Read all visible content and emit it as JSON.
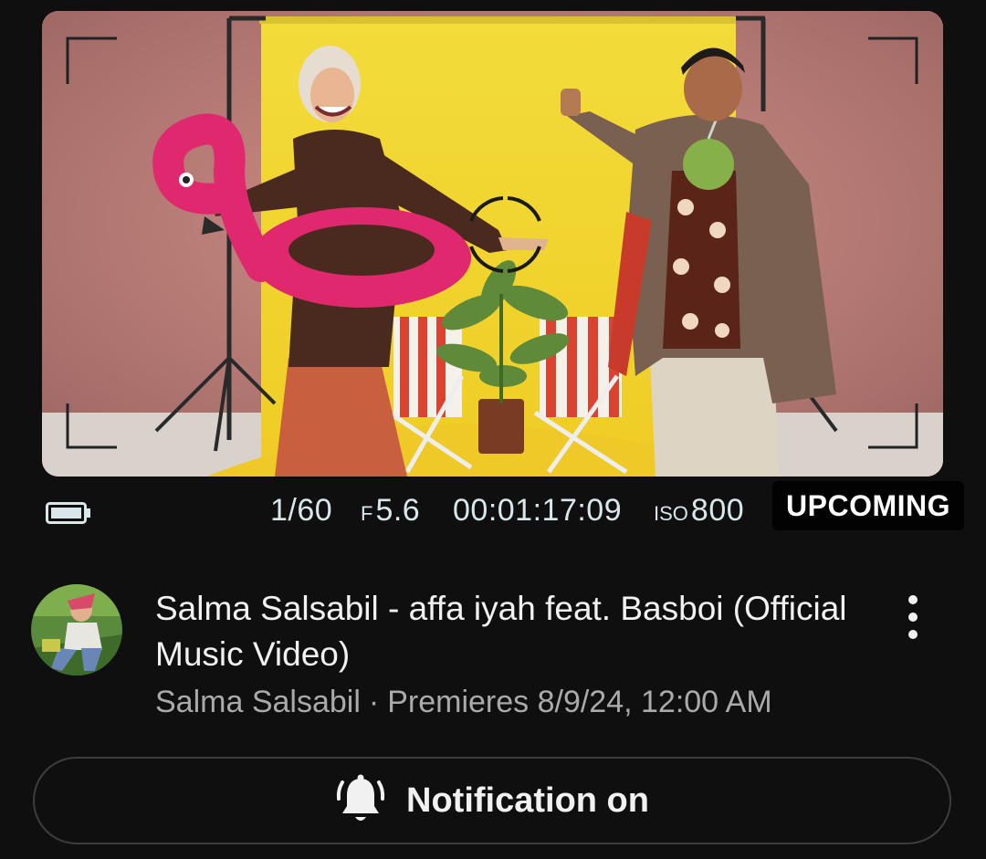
{
  "video": {
    "title": "Salma Salsabil - affa iyah feat. Basboi (Official Music Video)",
    "channel": "Salma Salsabil",
    "separator": "·",
    "premiere": "Premieres 8/9/24, 12:00 AM",
    "status_badge": "UPCOMING"
  },
  "thumbnail": {
    "camera": {
      "shutter": "1/60",
      "aperture_prefix": "F",
      "aperture": "5.6",
      "timecode": "00:01:17:09",
      "iso_prefix": "ISO",
      "iso": "800"
    },
    "icons": [
      "battery-icon",
      "focus-reticle-icon",
      "viewfinder-corner-icon"
    ]
  },
  "actions": {
    "notification_label": "Notification on",
    "notification_icon": "bell-ringing-icon",
    "more_icon": "more-vertical-icon"
  },
  "colors": {
    "background": "#0f0f0f",
    "text_primary": "#f1f1f1",
    "text_secondary": "#aaaaaa",
    "button_border": "#3d3d3d",
    "badge_bg": "#000000"
  }
}
